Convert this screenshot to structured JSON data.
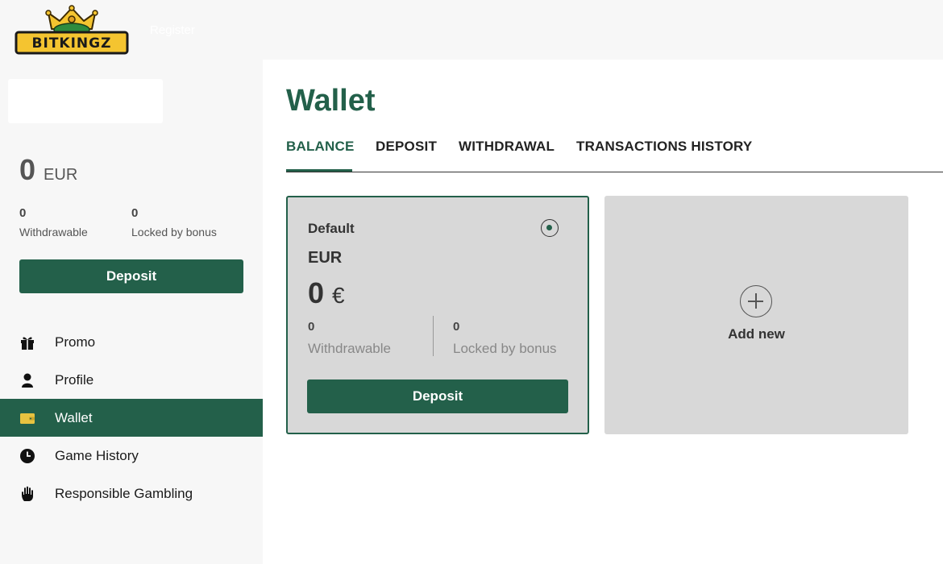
{
  "header": {
    "logo_text": "BITKINGZ",
    "link_label": "Register"
  },
  "sidebar": {
    "balance": {
      "amount": "0",
      "currency": "EUR"
    },
    "withdrawable": {
      "value": "0",
      "label": "Withdrawable"
    },
    "locked": {
      "value": "0",
      "label": "Locked by bonus"
    },
    "deposit_label": "Deposit",
    "nav": [
      {
        "label": "Promo",
        "icon": "gift-icon"
      },
      {
        "label": "Profile",
        "icon": "user-icon"
      },
      {
        "label": "Wallet",
        "icon": "wallet-icon",
        "active": true
      },
      {
        "label": "Game History",
        "icon": "clock-icon"
      },
      {
        "label": "Responsible Gambling",
        "icon": "hand-icon"
      }
    ]
  },
  "main": {
    "title": "Wallet",
    "tabs": [
      {
        "label": "BALANCE",
        "active": true
      },
      {
        "label": "DEPOSIT"
      },
      {
        "label": "WITHDRAWAL"
      },
      {
        "label": "TRANSACTIONS HISTORY"
      }
    ],
    "wallet_card": {
      "default_label": "Default",
      "currency": "EUR",
      "amount": "0",
      "symbol": "€",
      "withdrawable": {
        "value": "0",
        "label": "Withdrawable"
      },
      "locked": {
        "value": "0",
        "label": "Locked by bonus"
      },
      "deposit_label": "Deposit"
    },
    "add_new_label": "Add new"
  },
  "colors": {
    "brand_green": "#23604a",
    "card_bg": "#d8d8d8",
    "sidebar_bg": "#f7f7f7",
    "logo_yellow": "#f4c430"
  }
}
